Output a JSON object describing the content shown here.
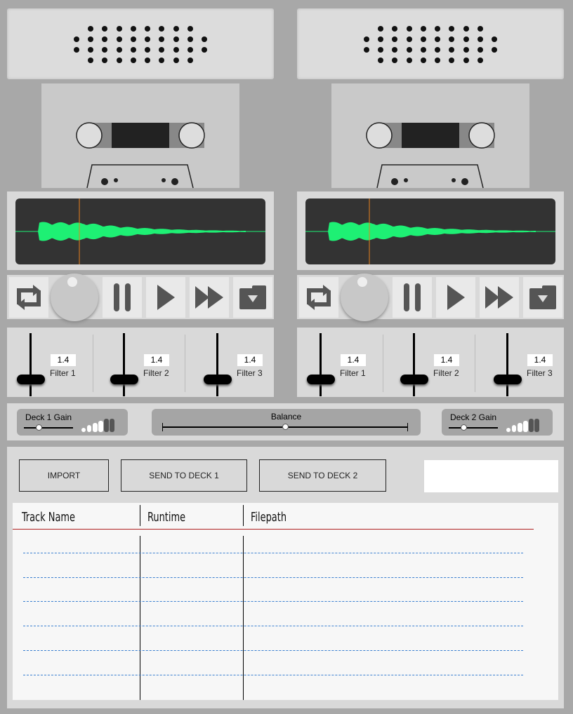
{
  "decks": [
    {
      "filters": [
        {
          "label": "Filter 1",
          "value": "1.4"
        },
        {
          "label": "Filter 2",
          "value": "1.4"
        },
        {
          "label": "Filter 3",
          "value": "1.4"
        }
      ]
    },
    {
      "filters": [
        {
          "label": "Filter 1",
          "value": "1.4"
        },
        {
          "label": "Filter 2",
          "value": "1.4"
        },
        {
          "label": "Filter 3",
          "value": "1.4"
        }
      ]
    }
  ],
  "mixer": {
    "deck1_gain": "Deck 1 Gain",
    "balance": "Balance",
    "deck2_gain": "Deck 2 Gain"
  },
  "library": {
    "import": "IMPORT",
    "send1": "SEND TO DECK 1",
    "send2": "SEND TO DECK 2",
    "search_value": "",
    "columns": [
      "Track Name",
      "Runtime",
      "Filepath"
    ]
  },
  "colors": {
    "waveform": "#1ef074",
    "playhead": "#e8821e",
    "header_rule": "#b02020",
    "row_rule": "#3a7fd0"
  }
}
